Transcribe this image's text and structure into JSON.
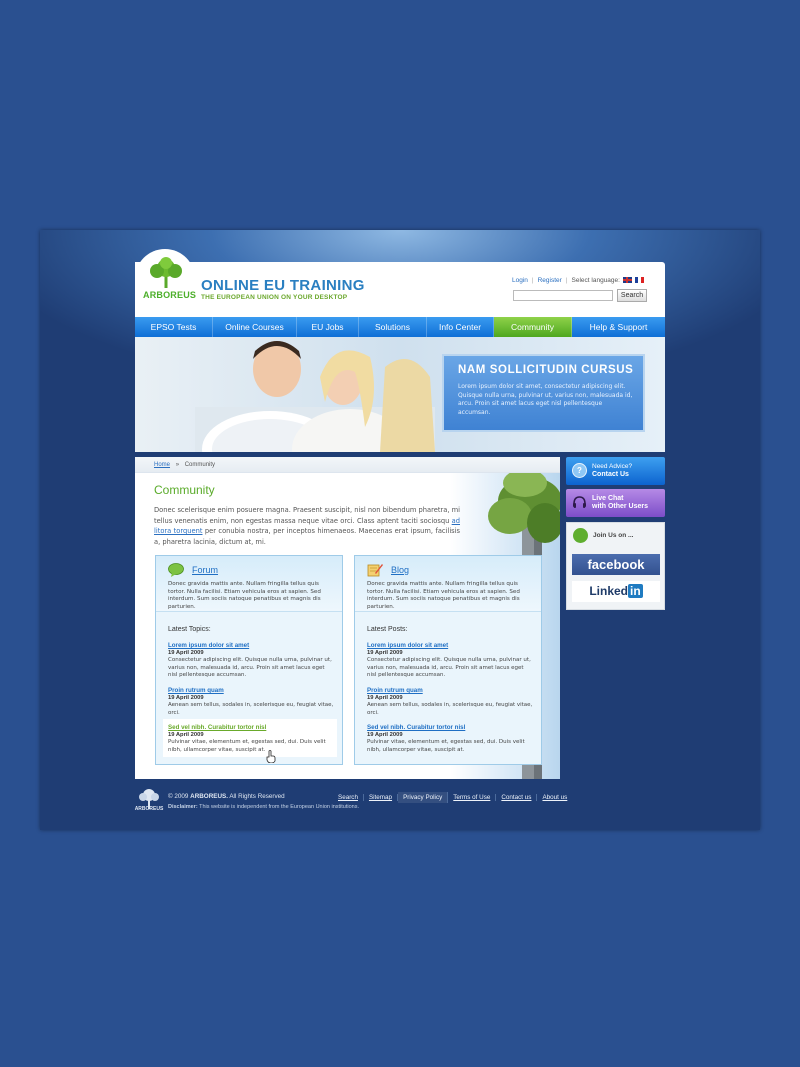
{
  "site": {
    "logo_text": "ARBOREUS",
    "title": "ONLINE EU TRAINING",
    "tagline": "THE EUROPEAN UNION ON YOUR DESKTOP"
  },
  "top": {
    "login": "Login",
    "register": "Register",
    "select_language": "Select language:",
    "search_placeholder": "",
    "search_button": "Search"
  },
  "nav": [
    {
      "label": "EPSO Tests",
      "active": false
    },
    {
      "label": "Online Courses",
      "active": false
    },
    {
      "label": "EU Jobs",
      "active": false
    },
    {
      "label": "Solutions",
      "active": false
    },
    {
      "label": "Info Center",
      "active": false
    },
    {
      "label": "Community",
      "active": true
    },
    {
      "label": "Help & Support",
      "active": false
    }
  ],
  "banner": {
    "title": "NAM SOLLICITUDIN CURSUS",
    "text": "Lorem ipsum dolor sit amet, consectetur adipiscing elit. Quisque nulla urna, pulvinar ut, varius non, malesuada id, arcu. Proin sit amet lacus eget nisl pellentesque accumsan."
  },
  "breadcrumb": {
    "home": "Home",
    "separator": "»",
    "current": "Community"
  },
  "page": {
    "title": "Community",
    "intro_before": "Donec scelerisque enim posuere magna. Praesent suscipit, nisl non bibendum pharetra, mi tellus venenatis enim, non egestas massa neque vitae orci. Class aptent taciti sociosqu ",
    "intro_link": "ad litora torquent",
    "intro_after": " per conubia nostra, per inceptos himenaeos. Maecenas erat ipsum, facilisis a, pharetra lacinia, dictum at, mi."
  },
  "forum": {
    "title": "Forum",
    "description": "Donec gravida mattis ante. Nullam fringilla tellus quis tortor. Nulla facilisi. Etiam vehicula eros at sapien. Sed interdum. Sum sociis natoque penatibus et magnis dis parturien.",
    "latest_label": "Latest Topics:",
    "entries": [
      {
        "title": "Lorem ipsum dolor sit amet",
        "date": "19 April 2009",
        "text": "Consectetur adipiscing elit. Quisque nulla urna, pulvinar ut, varius non, malesuada id, arcu. Proin sit amet lacus eget nisl pellentesque accumsan."
      },
      {
        "title": "Proin rutrum quam",
        "date": "19 April 2009",
        "text": "Aenean sem tellus, sodales in, scelerisque eu, feugiat vitae, orci."
      },
      {
        "title": "Sed vel nibh. Curabitur tortor nisl",
        "date": "19 April 2009",
        "text": "Pulvinar vitae, elementum et, egestas sed, dui. Duis velit nibh, ullamcorper vitae, suscipit at."
      }
    ]
  },
  "blog": {
    "title": "Blog",
    "description": "Donec gravida mattis ante. Nullam fringilla tellus quis tortor. Nulla facilisi. Etiam vehicula eros at sapien. Sed interdum. Sum sociis natoque penatibus et magnis dis parturien.",
    "latest_label": "Latest Posts:",
    "entries": [
      {
        "title": "Lorem ipsum dolor sit amet",
        "date": "19 April 2009",
        "text": "Consectetur adipiscing elit. Quisque nulla urna, pulvinar ut, varius non, malesuada id, arcu. Proin sit amet lacus eget nisl pellentesque accumsan."
      },
      {
        "title": "Proin rutrum quam",
        "date": "19 April 2009",
        "text": "Aenean sem tellus, sodales in, scelerisque eu, feugiat vitae, orci."
      },
      {
        "title": "Sed vel nibh. Curabitur tortor nisl",
        "date": "19 April 2009",
        "text": "Pulvinar vitae, elementum et, egestas sed, dui. Duis velit nibh, ullamcorper vitae, suscipit at."
      }
    ]
  },
  "sidebar": {
    "advice_line1": "Need Advice?",
    "advice_line2": "Contact Us",
    "chat_line1": "Live Chat",
    "chat_line2": "with Other Users",
    "join_label": "Join Us on ...",
    "facebook": "facebook",
    "linkedin_text": "Linked",
    "linkedin_in": "in"
  },
  "footer": {
    "logo_text": "ARBOREUS",
    "copyright_prefix": "© 2009 ",
    "copyright_brand": "ARBOREUS.",
    "copyright_suffix": " All Rights Reserved",
    "disclaimer_label": "Disclaimer:",
    "disclaimer_text": " This website is independent from the European Union institutions.",
    "links": [
      "Search",
      "Sitemap",
      "Privacy Policy",
      "Terms of Use",
      "Contact us",
      "About us"
    ]
  },
  "colors": {
    "page_bg": "#2a5090",
    "nav_blue": "#0f6fd6",
    "nav_active": "#4ea71f",
    "title_green": "#5aab2a",
    "link_blue": "#1f6fc4"
  }
}
